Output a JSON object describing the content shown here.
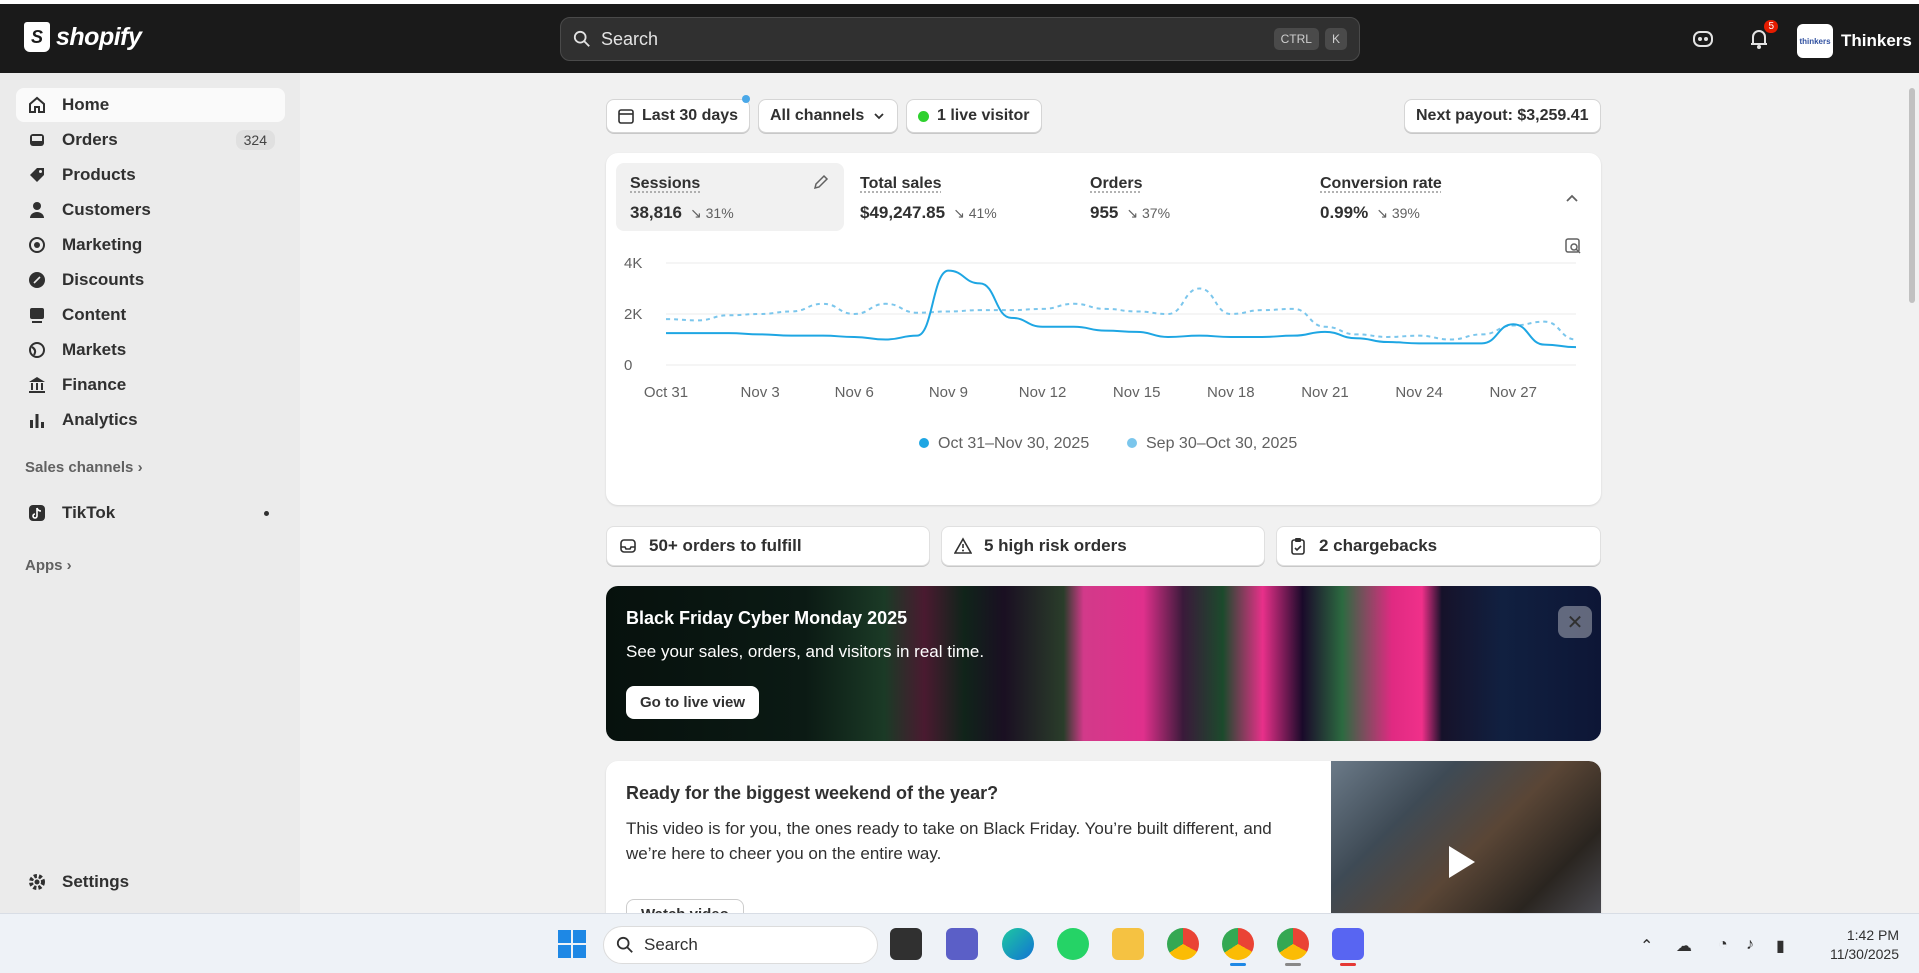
{
  "topbar": {
    "logo_text": "shopify",
    "search_placeholder": "Search",
    "kbd": [
      "CTRL",
      "K"
    ],
    "notification_count": "5",
    "store_name": "Thinkers",
    "store_avatar_text": "thinkers"
  },
  "sidebar": {
    "items": [
      {
        "label": "Home",
        "icon": "home-icon"
      },
      {
        "label": "Orders",
        "icon": "inbox-icon",
        "count": "324"
      },
      {
        "label": "Products",
        "icon": "tag-icon"
      },
      {
        "label": "Customers",
        "icon": "person-icon"
      },
      {
        "label": "Marketing",
        "icon": "target-icon"
      },
      {
        "label": "Discounts",
        "icon": "discount-icon"
      },
      {
        "label": "Content",
        "icon": "content-icon"
      },
      {
        "label": "Markets",
        "icon": "globe-icon"
      },
      {
        "label": "Finance",
        "icon": "bank-icon"
      },
      {
        "label": "Analytics",
        "icon": "bar-chart-icon"
      }
    ],
    "sales_channels_label": "Sales channels",
    "tiktok_label": "TikTok",
    "apps_label": "Apps",
    "settings_label": "Settings"
  },
  "controls": {
    "date_range": "Last 30 days",
    "channels": "All channels",
    "live_visitors": "1 live visitor",
    "payout": "Next payout: $3,259.41"
  },
  "metrics": [
    {
      "label": "Sessions",
      "value": "38,816",
      "delta": "31%"
    },
    {
      "label": "Total sales",
      "value": "$49,247.85",
      "delta": "41%"
    },
    {
      "label": "Orders",
      "value": "955",
      "delta": "37%"
    },
    {
      "label": "Conversion rate",
      "value": "0.99%",
      "delta": "39%"
    }
  ],
  "chart_data": {
    "type": "line",
    "x_ticks": [
      "Oct 31",
      "Nov 3",
      "Nov 6",
      "Nov 9",
      "Nov 12",
      "Nov 15",
      "Nov 18",
      "Nov 21",
      "Nov 24",
      "Nov 27"
    ],
    "y_ticks": [
      "0",
      "2K",
      "4K"
    ],
    "ylim": [
      0,
      4000
    ],
    "grid": true,
    "legend_position": "bottom",
    "series": [
      {
        "name": "Oct 31–Nov 30, 2025",
        "style": "solid",
        "color": "#1ea6e3",
        "values": [
          1250,
          1250,
          1250,
          1200,
          1150,
          1150,
          1100,
          1000,
          1150,
          3700,
          3200,
          1850,
          1500,
          1500,
          1350,
          1300,
          1100,
          1150,
          1100,
          1100,
          1150,
          1300,
          1050,
          900,
          850,
          850,
          850,
          1600,
          800,
          700
        ]
      },
      {
        "name": "Sep 30–Oct 30, 2025",
        "style": "dashed",
        "color": "#7bc6ec",
        "values": [
          1800,
          1750,
          1950,
          2000,
          2100,
          2400,
          2000,
          2400,
          2050,
          2100,
          2150,
          2150,
          2200,
          2400,
          2200,
          2100,
          2000,
          3000,
          2000,
          2150,
          2200,
          1500,
          1200,
          1100,
          1150,
          1000,
          1200,
          1550,
          1700,
          1000
        ]
      }
    ]
  },
  "alerts": [
    {
      "label": "50+ orders to fulfill",
      "icon": "inbox-icon"
    },
    {
      "label": "5 high risk orders",
      "icon": "warning-icon"
    },
    {
      "label": "2 chargebacks",
      "icon": "clipboard-icon"
    }
  ],
  "banner": {
    "title": "Black Friday Cyber Monday 2025",
    "subtitle": "See your sales, orders, and visitors in real time.",
    "button": "Go to live view"
  },
  "video_card": {
    "title": "Ready for the biggest weekend of the year?",
    "body": "This video is for you, the ones ready to take on Black Friday. You’re built different, and we’re here to cheer you on the entire way.",
    "button": "Watch video"
  },
  "taskbar": {
    "search_label": "Search",
    "time": "1:42 PM",
    "date": "11/30/2025"
  }
}
